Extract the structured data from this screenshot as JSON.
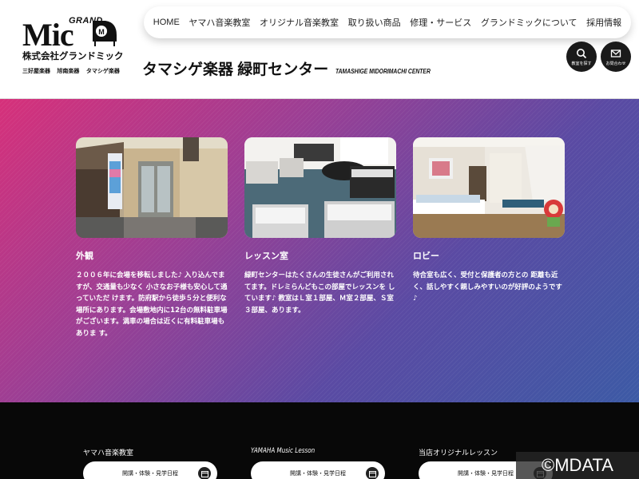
{
  "logo": {
    "grand": "GRAND",
    "mic": "Mic",
    "company": "株式会社グランドミック",
    "subsidiaries": "三好屋楽器 旭南楽器 タマシゲ楽器"
  },
  "nav": {
    "items": [
      "HOME",
      "ヤマハ音楽教室",
      "オリジナル音楽教室",
      "取り扱い商品",
      "修理・サービス",
      "グランドミックについて",
      "採用情報"
    ]
  },
  "header": {
    "title": "タマシゲ楽器 緑町センター",
    "subtitle": "TAMASHIGE MIDORIMACHI CENTER",
    "search_label": "教室を探す",
    "contact_label": "お問合わせ"
  },
  "cards": [
    {
      "heading": "外観",
      "text": "２００６年に会場を移転しました♪ 入り込んでますが、交通量も少なく 小さなお子様も安心して通っていただ けます。防府駅から徒歩５分と便利な場所にあります。会場敷地内に12台の無料駐車場がございます。満車の場合は近くに有料駐車場もありま す。"
    },
    {
      "heading": "レッスン室",
      "text": "緑町センターはたくさんの生徒さんがご利用されてます。ドレミらんどもこの部屋でレッスンを しています♪ 教室はＬ室１部屋、Ｍ室２部屋、Ｓ室３部屋、あります。"
    },
    {
      "heading": "ロビー",
      "text": "待合室も広く、受付と保護者の方との 距離も近く、話しやすく親しみやすいのが好評のようです♪"
    }
  ],
  "footer": {
    "columns": [
      {
        "heading": "ヤマハ音楽教室",
        "button": "開講・体験・見学日程"
      },
      {
        "heading": "YAMAHA Music Lesson",
        "button": "開講・体験・見学日程"
      },
      {
        "heading": "当店オリジナルレッスン",
        "button": "開講・体験・見学日程"
      }
    ]
  },
  "copyright": "©MDATA",
  "colors": {
    "gradient_start": "#d6307a",
    "gradient_end": "#3c5aa5",
    "footer_bg": "#080808",
    "text_on_gradient": "#ffffff"
  }
}
